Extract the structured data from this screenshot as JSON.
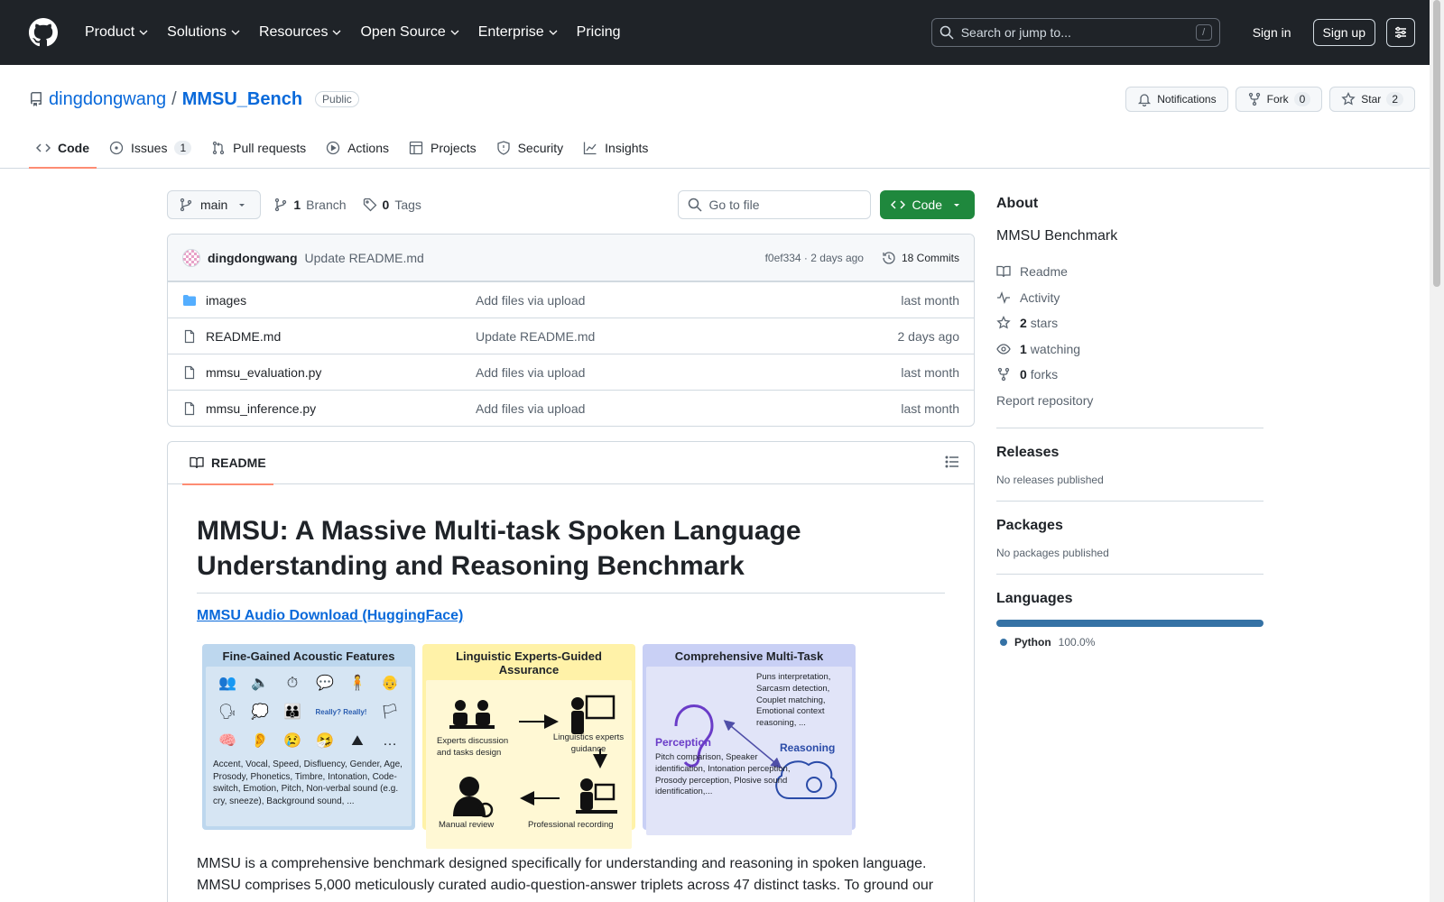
{
  "header": {
    "nav": [
      "Product",
      "Solutions",
      "Resources",
      "Open Source",
      "Enterprise",
      "Pricing"
    ],
    "search_placeholder": "Search or jump to...",
    "search_key": "/",
    "signin": "Sign in",
    "signup": "Sign up"
  },
  "repo": {
    "owner": "dingdongwang",
    "separator": "/",
    "name": "MMSU_Bench",
    "visibility": "Public",
    "notifications": "Notifications",
    "fork_label": "Fork",
    "fork_count": "0",
    "star_label": "Star",
    "star_count": "2"
  },
  "tabs": [
    {
      "label": "Code",
      "count": ""
    },
    {
      "label": "Issues",
      "count": "1"
    },
    {
      "label": "Pull requests",
      "count": ""
    },
    {
      "label": "Actions",
      "count": ""
    },
    {
      "label": "Projects",
      "count": ""
    },
    {
      "label": "Security",
      "count": ""
    },
    {
      "label": "Insights",
      "count": ""
    }
  ],
  "filenav": {
    "branch": "main",
    "branch_count": "1",
    "branch_label": "Branch",
    "tag_count": "0",
    "tag_label": "Tags",
    "goto_placeholder": "Go to file",
    "code_btn": "Code"
  },
  "commit": {
    "author": "dingdongwang",
    "message": "Update README.md",
    "meta": "f0ef334 · 2 days ago",
    "commits": "18 Commits"
  },
  "files": [
    {
      "name": "images",
      "type": "folder",
      "commit": "Add files via upload",
      "age": "last month"
    },
    {
      "name": "README.md",
      "type": "file",
      "commit": "Update README.md",
      "age": "2 days ago"
    },
    {
      "name": "mmsu_evaluation.py",
      "type": "file",
      "commit": "Add files via upload",
      "age": "last month"
    },
    {
      "name": "mmsu_inference.py",
      "type": "file",
      "commit": "Add files via upload",
      "age": "last month"
    }
  ],
  "readme": {
    "tab": "README",
    "title": "MMSU: A Massive Multi-task Spoken Language Understanding and Reasoning Benchmark",
    "hf_link": "MMSU Audio Download (HuggingFace)",
    "panels": {
      "p1_title": "Fine-Gained Acoustic Features",
      "p1_text": "Accent, Vocal, Speed, Disfluency, Gender, Age, Prosody, Phonetics, Timbre, Intonation, Code-switch, Emotion, Pitch, Non-verbal sound (e.g. cry, sneeze), Background sound, ...",
      "p1_really": "Really? Really!",
      "p2_title": "Linguistic Experts-Guided Assurance",
      "p2_a": "Experts discussion and tasks design",
      "p2_b": "Linguistics experts guidance",
      "p2_c": "Manual review",
      "p2_d": "Professional recording",
      "p3_title": "Comprehensive Multi-Task",
      "p3_tasks": "Puns interpretation, Sarcasm detection, Couplet matching, Emotional context reasoning, ...",
      "p3_reasoning": "Reasoning",
      "p3_perception": "Perception",
      "p3_list": "Pitch comparison, Speaker identification, Intonation perception, Prosody perception, Plosive sound identification,..."
    },
    "paragraph": "MMSU is a comprehensive benchmark designed specifically for understanding and reasoning in spoken language. MMSU comprises 5,000 meticulously curated audio-question-answer triplets across 47 distinct tasks. To ground our"
  },
  "about": {
    "heading": "About",
    "description": "MMSU Benchmark",
    "readme": "Readme",
    "activity": "Activity",
    "stars_n": "2",
    "stars": "stars",
    "watching_n": "1",
    "watching": "watching",
    "forks_n": "0",
    "forks": "forks",
    "report": "Report repository"
  },
  "releases": {
    "heading": "Releases",
    "text": "No releases published"
  },
  "packages": {
    "heading": "Packages",
    "text": "No packages published"
  },
  "languages": {
    "heading": "Languages",
    "name": "Python",
    "percent": "100.0%",
    "color": "#3572A5"
  }
}
